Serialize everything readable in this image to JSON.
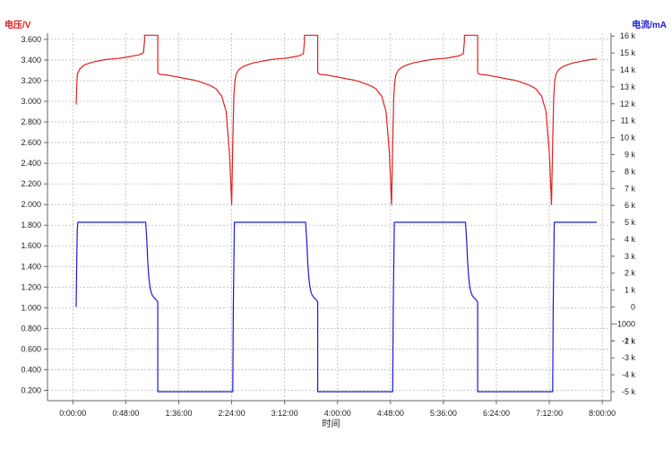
{
  "chart_data": {
    "type": "line",
    "xlabel": "时间",
    "y_left_label": "电压/V",
    "y_right_label": "电流/mA",
    "colors": {
      "voltage": "#e02020",
      "current": "#1a1ad8",
      "grid": "#b9b9b9",
      "axis": "#666666"
    },
    "x_ticks": [
      "0:00:00",
      "0:48:00",
      "1:36:00",
      "2:24:00",
      "3:12:00",
      "4:00:00",
      "4:48:00",
      "5:36:00",
      "6:24:00",
      "7:12:00",
      "8:00:00"
    ],
    "x_tick_minutes": [
      0,
      48,
      96,
      144,
      192,
      240,
      288,
      336,
      384,
      432,
      480
    ],
    "xlim_minutes": [
      -23,
      488
    ],
    "y_left_ticks": [
      "0.200",
      "0.400",
      "0.600",
      "0.800",
      "1.000",
      "1.200",
      "1.400",
      "1.600",
      "1.800",
      "2.000",
      "2.200",
      "2.400",
      "2.600",
      "2.800",
      "3.000",
      "3.200",
      "3.400",
      "3.600"
    ],
    "y_left_values": [
      0.2,
      0.4,
      0.6,
      0.8,
      1.0,
      1.2,
      1.4,
      1.6,
      1.8,
      2.0,
      2.2,
      2.4,
      2.6,
      2.8,
      3.0,
      3.2,
      3.4,
      3.6
    ],
    "ylim_left": [
      0.1,
      3.66
    ],
    "y_right_ticks": [
      "-5 k",
      "-4 k",
      "-3 k",
      "-2 k",
      "-1 k",
      "-1000",
      "0",
      "1 k",
      "2 k",
      "3 k",
      "4 k",
      "5 k",
      "6 k",
      "7 k",
      "8 k",
      "9 k",
      "10 k",
      "11 k",
      "12 k",
      "13 k",
      "14 k",
      "15 k",
      "16 k"
    ],
    "y_right_values": [
      -5000,
      -4000,
      -3000,
      -2000,
      -1000,
      -1000,
      0,
      1000,
      2000,
      3000,
      4000,
      5000,
      6000,
      7000,
      8000,
      9000,
      10000,
      11000,
      12000,
      13000,
      14000,
      15000,
      16000
    ],
    "ylim_right": [
      -5530,
      16170
    ],
    "grid": true,
    "series": [
      {
        "name": "电压/V",
        "axis": "left",
        "x_minutes": [
          3,
          4,
          6,
          8,
          10,
          15,
          20,
          25,
          30,
          35,
          40,
          45,
          50,
          55,
          60,
          64,
          65,
          65,
          77,
          77,
          78,
          80,
          85,
          90,
          95,
          100,
          105,
          110,
          115,
          120,
          125,
          130,
          135,
          139,
          142,
          144,
          145,
          146,
          147,
          148,
          150,
          152,
          155,
          160,
          165,
          170,
          175,
          180,
          185,
          190,
          195,
          200,
          205,
          209,
          210,
          210,
          222,
          222,
          223,
          225,
          230,
          235,
          240,
          245,
          250,
          255,
          260,
          265,
          270,
          275,
          280,
          284,
          287,
          289,
          290,
          291,
          292,
          293,
          295,
          297,
          300,
          305,
          310,
          315,
          320,
          325,
          330,
          335,
          340,
          345,
          350,
          354,
          355,
          355,
          367,
          367,
          368,
          370,
          375,
          380,
          385,
          390,
          395,
          400,
          405,
          410,
          415,
          420,
          425,
          429,
          432,
          434,
          435,
          436,
          437,
          438,
          440,
          442,
          445,
          450,
          455,
          460,
          465,
          470,
          475
        ],
        "values": [
          2.97,
          3.26,
          3.31,
          3.33,
          3.35,
          3.37,
          3.385,
          3.395,
          3.405,
          3.41,
          3.415,
          3.42,
          3.43,
          3.44,
          3.45,
          3.47,
          3.58,
          3.64,
          3.64,
          3.28,
          3.265,
          3.26,
          3.255,
          3.245,
          3.235,
          3.225,
          3.215,
          3.205,
          3.19,
          3.17,
          3.15,
          3.12,
          3.05,
          2.9,
          2.5,
          2.0,
          2.6,
          3.05,
          3.2,
          3.26,
          3.3,
          3.32,
          3.34,
          3.36,
          3.375,
          3.385,
          3.395,
          3.405,
          3.41,
          3.415,
          3.42,
          3.43,
          3.44,
          3.46,
          3.58,
          3.64,
          3.64,
          3.28,
          3.265,
          3.26,
          3.255,
          3.245,
          3.235,
          3.225,
          3.215,
          3.205,
          3.19,
          3.17,
          3.15,
          3.12,
          3.05,
          2.9,
          2.5,
          2.0,
          2.6,
          3.05,
          3.2,
          3.26,
          3.3,
          3.32,
          3.34,
          3.36,
          3.375,
          3.385,
          3.395,
          3.405,
          3.41,
          3.415,
          3.42,
          3.43,
          3.44,
          3.46,
          3.58,
          3.64,
          3.64,
          3.28,
          3.265,
          3.26,
          3.255,
          3.245,
          3.235,
          3.225,
          3.215,
          3.205,
          3.19,
          3.17,
          3.15,
          3.12,
          3.05,
          2.9,
          2.5,
          2.0,
          2.6,
          3.05,
          3.2,
          3.26,
          3.3,
          3.32,
          3.34,
          3.36,
          3.375,
          3.385,
          3.395,
          3.405,
          3.41
        ]
      },
      {
        "name": "电流/mA",
        "axis": "right",
        "x_minutes": [
          3,
          3.5,
          4,
          4.5,
          66,
          67,
          68,
          69,
          70,
          71,
          72,
          73,
          74,
          75,
          76,
          77,
          77,
          145,
          145.5,
          146,
          146.5,
          211,
          212,
          213,
          214,
          215,
          216,
          217,
          218,
          219,
          220,
          221,
          222,
          222,
          290,
          290.5,
          291,
          291.5,
          356,
          357,
          358,
          359,
          360,
          361,
          362,
          363,
          364,
          365,
          366,
          367,
          367,
          435,
          435.5,
          436,
          436.5,
          475
        ],
        "values": [
          0,
          2500,
          4500,
          5000,
          5000,
          4000,
          2600,
          1700,
          1150,
          870,
          700,
          600,
          530,
          470,
          400,
          300,
          -5000,
          -5000,
          0,
          2500,
          5000,
          5000,
          4000,
          2600,
          1700,
          1150,
          870,
          700,
          600,
          530,
          470,
          400,
          300,
          -5000,
          -5000,
          0,
          2500,
          5000,
          5000,
          4000,
          2600,
          1700,
          1150,
          870,
          700,
          600,
          530,
          470,
          400,
          300,
          -5000,
          -5000,
          0,
          2500,
          5000,
          5000
        ]
      }
    ]
  }
}
